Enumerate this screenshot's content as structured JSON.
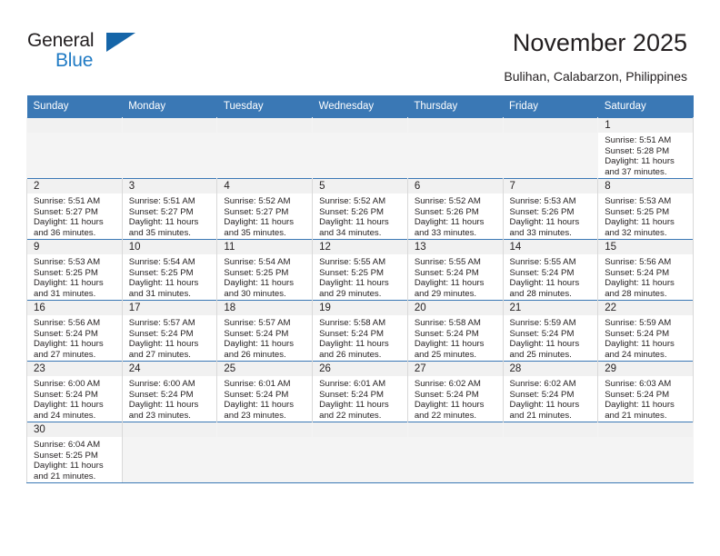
{
  "brand": {
    "name_part1": "General",
    "name_part2": "Blue",
    "triangle_icon": "triangle-logo-mark",
    "color_black": "#231f20",
    "color_blue": "#1f7ac4",
    "color_triangle": "#1565a8"
  },
  "header": {
    "title": "November 2025",
    "subtitle": "Bulihan, Calabarzon, Philippines"
  },
  "theme": {
    "header_row_bg": "#3a78b5",
    "header_row_text": "#ffffff",
    "daynum_band_bg": "#f1f1f1",
    "empty_cell_bg": "#f4f4f4",
    "grid_line": "#d9d9d9",
    "rule_line": "#3a78b5"
  },
  "weekday_headers": [
    "Sunday",
    "Monday",
    "Tuesday",
    "Wednesday",
    "Thursday",
    "Friday",
    "Saturday"
  ],
  "weeks": [
    [
      {
        "empty": true
      },
      {
        "empty": true
      },
      {
        "empty": true
      },
      {
        "empty": true
      },
      {
        "empty": true
      },
      {
        "empty": true
      },
      {
        "empty": false,
        "day": "1",
        "sunrise": "Sunrise: 5:51 AM",
        "sunset": "Sunset: 5:28 PM",
        "daylight": "Daylight: 11 hours and 37 minutes."
      }
    ],
    [
      {
        "empty": false,
        "day": "2",
        "sunrise": "Sunrise: 5:51 AM",
        "sunset": "Sunset: 5:27 PM",
        "daylight": "Daylight: 11 hours and 36 minutes."
      },
      {
        "empty": false,
        "day": "3",
        "sunrise": "Sunrise: 5:51 AM",
        "sunset": "Sunset: 5:27 PM",
        "daylight": "Daylight: 11 hours and 35 minutes."
      },
      {
        "empty": false,
        "day": "4",
        "sunrise": "Sunrise: 5:52 AM",
        "sunset": "Sunset: 5:27 PM",
        "daylight": "Daylight: 11 hours and 35 minutes."
      },
      {
        "empty": false,
        "day": "5",
        "sunrise": "Sunrise: 5:52 AM",
        "sunset": "Sunset: 5:26 PM",
        "daylight": "Daylight: 11 hours and 34 minutes."
      },
      {
        "empty": false,
        "day": "6",
        "sunrise": "Sunrise: 5:52 AM",
        "sunset": "Sunset: 5:26 PM",
        "daylight": "Daylight: 11 hours and 33 minutes."
      },
      {
        "empty": false,
        "day": "7",
        "sunrise": "Sunrise: 5:53 AM",
        "sunset": "Sunset: 5:26 PM",
        "daylight": "Daylight: 11 hours and 33 minutes."
      },
      {
        "empty": false,
        "day": "8",
        "sunrise": "Sunrise: 5:53 AM",
        "sunset": "Sunset: 5:25 PM",
        "daylight": "Daylight: 11 hours and 32 minutes."
      }
    ],
    [
      {
        "empty": false,
        "day": "9",
        "sunrise": "Sunrise: 5:53 AM",
        "sunset": "Sunset: 5:25 PM",
        "daylight": "Daylight: 11 hours and 31 minutes."
      },
      {
        "empty": false,
        "day": "10",
        "sunrise": "Sunrise: 5:54 AM",
        "sunset": "Sunset: 5:25 PM",
        "daylight": "Daylight: 11 hours and 31 minutes."
      },
      {
        "empty": false,
        "day": "11",
        "sunrise": "Sunrise: 5:54 AM",
        "sunset": "Sunset: 5:25 PM",
        "daylight": "Daylight: 11 hours and 30 minutes."
      },
      {
        "empty": false,
        "day": "12",
        "sunrise": "Sunrise: 5:55 AM",
        "sunset": "Sunset: 5:25 PM",
        "daylight": "Daylight: 11 hours and 29 minutes."
      },
      {
        "empty": false,
        "day": "13",
        "sunrise": "Sunrise: 5:55 AM",
        "sunset": "Sunset: 5:24 PM",
        "daylight": "Daylight: 11 hours and 29 minutes."
      },
      {
        "empty": false,
        "day": "14",
        "sunrise": "Sunrise: 5:55 AM",
        "sunset": "Sunset: 5:24 PM",
        "daylight": "Daylight: 11 hours and 28 minutes."
      },
      {
        "empty": false,
        "day": "15",
        "sunrise": "Sunrise: 5:56 AM",
        "sunset": "Sunset: 5:24 PM",
        "daylight": "Daylight: 11 hours and 28 minutes."
      }
    ],
    [
      {
        "empty": false,
        "day": "16",
        "sunrise": "Sunrise: 5:56 AM",
        "sunset": "Sunset: 5:24 PM",
        "daylight": "Daylight: 11 hours and 27 minutes."
      },
      {
        "empty": false,
        "day": "17",
        "sunrise": "Sunrise: 5:57 AM",
        "sunset": "Sunset: 5:24 PM",
        "daylight": "Daylight: 11 hours and 27 minutes."
      },
      {
        "empty": false,
        "day": "18",
        "sunrise": "Sunrise: 5:57 AM",
        "sunset": "Sunset: 5:24 PM",
        "daylight": "Daylight: 11 hours and 26 minutes."
      },
      {
        "empty": false,
        "day": "19",
        "sunrise": "Sunrise: 5:58 AM",
        "sunset": "Sunset: 5:24 PM",
        "daylight": "Daylight: 11 hours and 26 minutes."
      },
      {
        "empty": false,
        "day": "20",
        "sunrise": "Sunrise: 5:58 AM",
        "sunset": "Sunset: 5:24 PM",
        "daylight": "Daylight: 11 hours and 25 minutes."
      },
      {
        "empty": false,
        "day": "21",
        "sunrise": "Sunrise: 5:59 AM",
        "sunset": "Sunset: 5:24 PM",
        "daylight": "Daylight: 11 hours and 25 minutes."
      },
      {
        "empty": false,
        "day": "22",
        "sunrise": "Sunrise: 5:59 AM",
        "sunset": "Sunset: 5:24 PM",
        "daylight": "Daylight: 11 hours and 24 minutes."
      }
    ],
    [
      {
        "empty": false,
        "day": "23",
        "sunrise": "Sunrise: 6:00 AM",
        "sunset": "Sunset: 5:24 PM",
        "daylight": "Daylight: 11 hours and 24 minutes."
      },
      {
        "empty": false,
        "day": "24",
        "sunrise": "Sunrise: 6:00 AM",
        "sunset": "Sunset: 5:24 PM",
        "daylight": "Daylight: 11 hours and 23 minutes."
      },
      {
        "empty": false,
        "day": "25",
        "sunrise": "Sunrise: 6:01 AM",
        "sunset": "Sunset: 5:24 PM",
        "daylight": "Daylight: 11 hours and 23 minutes."
      },
      {
        "empty": false,
        "day": "26",
        "sunrise": "Sunrise: 6:01 AM",
        "sunset": "Sunset: 5:24 PM",
        "daylight": "Daylight: 11 hours and 22 minutes."
      },
      {
        "empty": false,
        "day": "27",
        "sunrise": "Sunrise: 6:02 AM",
        "sunset": "Sunset: 5:24 PM",
        "daylight": "Daylight: 11 hours and 22 minutes."
      },
      {
        "empty": false,
        "day": "28",
        "sunrise": "Sunrise: 6:02 AM",
        "sunset": "Sunset: 5:24 PM",
        "daylight": "Daylight: 11 hours and 21 minutes."
      },
      {
        "empty": false,
        "day": "29",
        "sunrise": "Sunrise: 6:03 AM",
        "sunset": "Sunset: 5:24 PM",
        "daylight": "Daylight: 11 hours and 21 minutes."
      }
    ],
    [
      {
        "empty": false,
        "day": "30",
        "sunrise": "Sunrise: 6:04 AM",
        "sunset": "Sunset: 5:25 PM",
        "daylight": "Daylight: 11 hours and 21 minutes."
      },
      {
        "empty": true
      },
      {
        "empty": true
      },
      {
        "empty": true
      },
      {
        "empty": true
      },
      {
        "empty": true
      },
      {
        "empty": true
      }
    ]
  ]
}
